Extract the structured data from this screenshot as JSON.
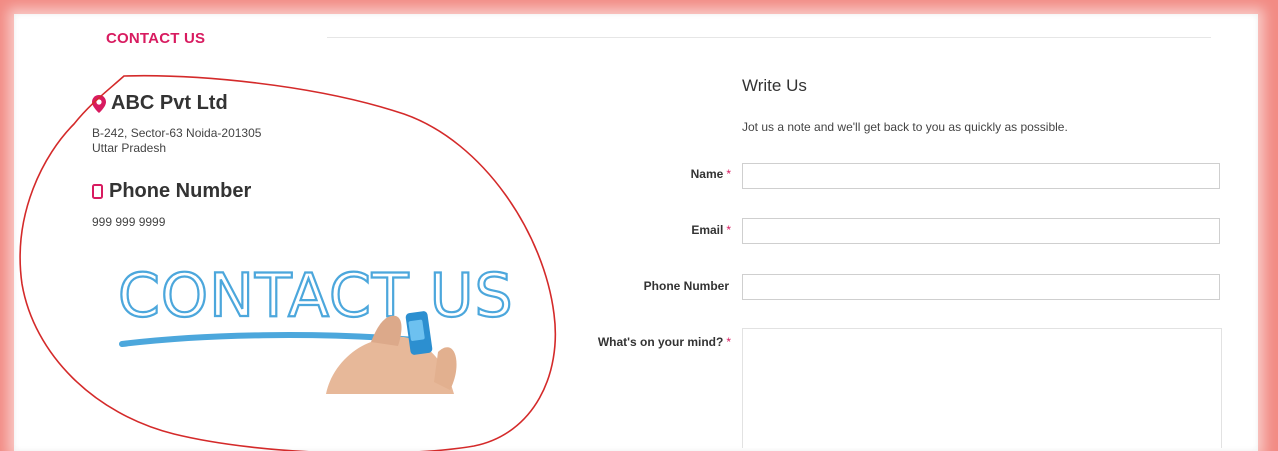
{
  "section_title": "CONTACT US",
  "company": {
    "name": "ABC Pvt Ltd",
    "address_line1": "B-242, Sector-63 Noida-201305",
    "address_line2": "Uttar Pradesh"
  },
  "phone": {
    "heading": "Phone Number",
    "number": "999 999 9999"
  },
  "banner_image": {
    "text": "CONTACT US"
  },
  "form": {
    "title": "Write Us",
    "subtitle": "Jot us a note and we'll get back to you as quickly as possible.",
    "name_label": "Name",
    "email_label": "Email",
    "phone_label": "Phone Number",
    "message_label": "What's on your mind?",
    "required_mark": "*",
    "name_value": "",
    "email_value": "",
    "phone_value": "",
    "message_value": ""
  },
  "colors": {
    "accent": "#d81b60",
    "annotation": "#d42a2a",
    "frame": "#f28b84"
  },
  "icons": {
    "location": "map-pin-icon",
    "phone": "mobile-phone-icon"
  }
}
